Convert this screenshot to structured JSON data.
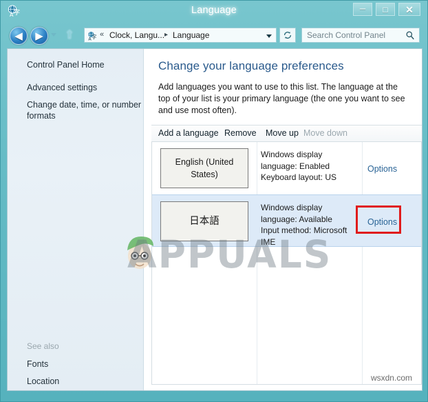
{
  "window": {
    "title": "Language",
    "app_icon": "language-icon",
    "controls": {
      "minimize": "–",
      "maximize": "□",
      "close": "✕"
    }
  },
  "nav": {
    "back_icon": "◀",
    "forward_icon": "▶",
    "history_icon": "chevron-down-icon",
    "up_icon": "⇧",
    "address": {
      "icon": "language-icon",
      "chevrons": "«",
      "crumb1": "Clock, Langu...",
      "separator": "▸",
      "crumb2": "Language",
      "dropdown_icon": "chevron-down-icon"
    },
    "refresh_icon": "↻",
    "search": {
      "placeholder": "Search Control Panel",
      "icon": "search-icon"
    }
  },
  "sidebar": {
    "home": "Control Panel Home",
    "advanced": "Advanced settings",
    "formats": "Change date, time, or number formats",
    "see_also_label": "See also",
    "fonts": "Fonts",
    "location": "Location"
  },
  "main": {
    "title": "Change your language preferences",
    "description": "Add languages you want to use to this list. The language at the top of your list is your primary language (the one you want to see and use most often)."
  },
  "toolbar": {
    "add_language": "Add a language",
    "remove": "Remove",
    "move_up": "Move up",
    "move_down": "Move down"
  },
  "languages": [
    {
      "name": "English (United States)",
      "status": "Windows display language: Enabled\nKeyboard layout: US",
      "options_label": "Options",
      "selected": false,
      "highlighted": false
    },
    {
      "name": "日本語",
      "status": "Windows display language: Available\nInput method: Microsoft IME",
      "options_label": "Options",
      "selected": true,
      "highlighted": true
    }
  ],
  "annotation": {
    "highlight_color": "#e01b1b",
    "target": "options-link-japanese"
  },
  "watermarks": {
    "center": "APPUALS",
    "corner": "wsxdn.com"
  },
  "colors": {
    "window_frame": "#56b2bd",
    "title_text": "#ffffff",
    "heading": "#2a5a8c",
    "link": "#2a6496",
    "selection": "#ddeaf8",
    "sidebar_bg": "#e6eff6"
  }
}
